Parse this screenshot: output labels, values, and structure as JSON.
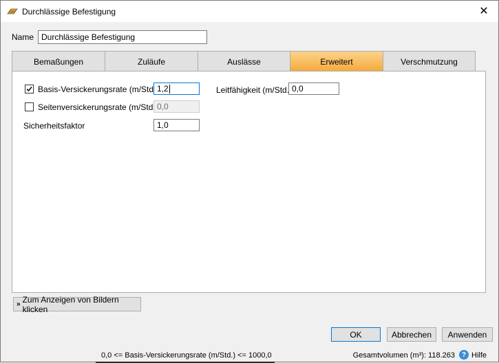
{
  "window": {
    "title": "Durchlässige Befestigung",
    "close_glyph": "✕"
  },
  "name": {
    "label": "Name",
    "value": "Durchlässige Befestigung"
  },
  "tabs": [
    {
      "label": "Bemaßungen",
      "active": false
    },
    {
      "label": "Zuläufe",
      "active": false
    },
    {
      "label": "Auslässe",
      "active": false
    },
    {
      "label": "Erweitert",
      "active": true
    },
    {
      "label": "Verschmutzung",
      "active": false
    }
  ],
  "advanced": {
    "basis_rate": {
      "label": "Basis-Versickerungsrate (m/Std.)",
      "checked": true,
      "value": "1,2"
    },
    "side_rate": {
      "label": "Seitenversickerungsrate (m/Std.)",
      "checked": false,
      "value": "0,0"
    },
    "safety_factor": {
      "label": "Sicherheitsfaktor",
      "value": "1,0"
    },
    "conductivity": {
      "label": "Leitfähigkeit (m/Std.)",
      "value": "0,0"
    }
  },
  "show_images_button": "Zum Anzeigen von Bildern klicken",
  "buttons": {
    "ok": "OK",
    "cancel": "Abbrechen",
    "apply": "Anwenden"
  },
  "status": {
    "hint": "0,0 <= Basis-Versickerungsrate (m/Std.) <= 1000,0",
    "total_volume": "Gesamtvolumen (m³): 118.263",
    "help": "Hilfe"
  },
  "colors": {
    "active_tab": "#f5a93b",
    "focus_border": "#0078d7",
    "help_icon": "#3a8fd8"
  }
}
